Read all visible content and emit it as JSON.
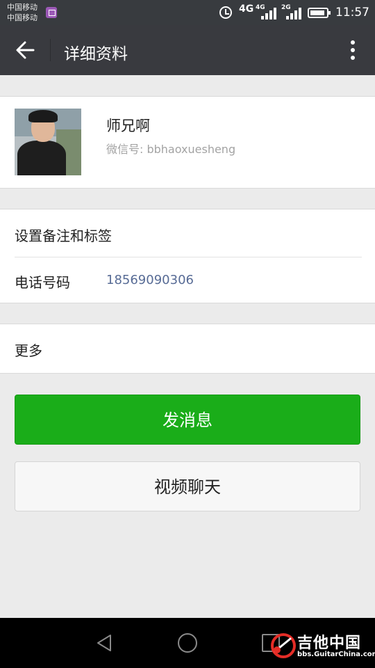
{
  "status_bar": {
    "carrier_1": "中国移动",
    "carrier_2": "中国移动",
    "network_1": "4G",
    "network_2": "4G",
    "network_3": "2G",
    "time": "11:57"
  },
  "header": {
    "title": "详细资料"
  },
  "profile": {
    "nickname": "师兄啊",
    "wechat_id": "微信号: bbhaoxuesheng"
  },
  "info": {
    "remark_label": "设置备注和标签",
    "phone_label": "电话号码",
    "phone_value": "18569090306"
  },
  "more": {
    "label": "更多"
  },
  "actions": {
    "send_message": "发消息",
    "video_chat": "视频聊天"
  },
  "watermark": {
    "title": "吉他中国",
    "url": "bbs.GuitarChina.com"
  },
  "colors": {
    "primary_green": "#1aad19",
    "header_bg": "#393a3f",
    "link_blue": "#576b95"
  }
}
